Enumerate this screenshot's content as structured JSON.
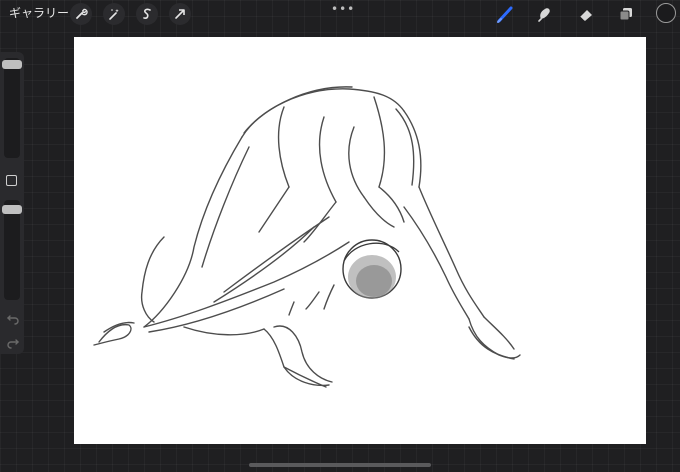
{
  "toolbar": {
    "gallery_label": "ギャラリー",
    "left_tools": [
      "wrench-icon",
      "magic-wand-icon",
      "selection-icon",
      "transform-arrow-icon"
    ],
    "more_label": "•••",
    "right_tools": [
      "brush-icon",
      "smudge-icon",
      "eraser-icon",
      "layers-icon",
      "color-icon"
    ],
    "active_tool": "brush"
  },
  "colors": {
    "background": "#1f1f21",
    "canvas": "#ffffff",
    "active_tool_accent": "#2d6bff",
    "current_color": "#1b1b1d",
    "sketch_stroke": "#3a3a3a"
  },
  "sidebar": {
    "brush_size_level": 0.95,
    "opacity_level": 0.9,
    "buttons": [
      "modify-square-icon",
      "undo-icon",
      "redo-icon"
    ]
  },
  "canvas": {
    "content": "pencil-figure-sketch"
  }
}
